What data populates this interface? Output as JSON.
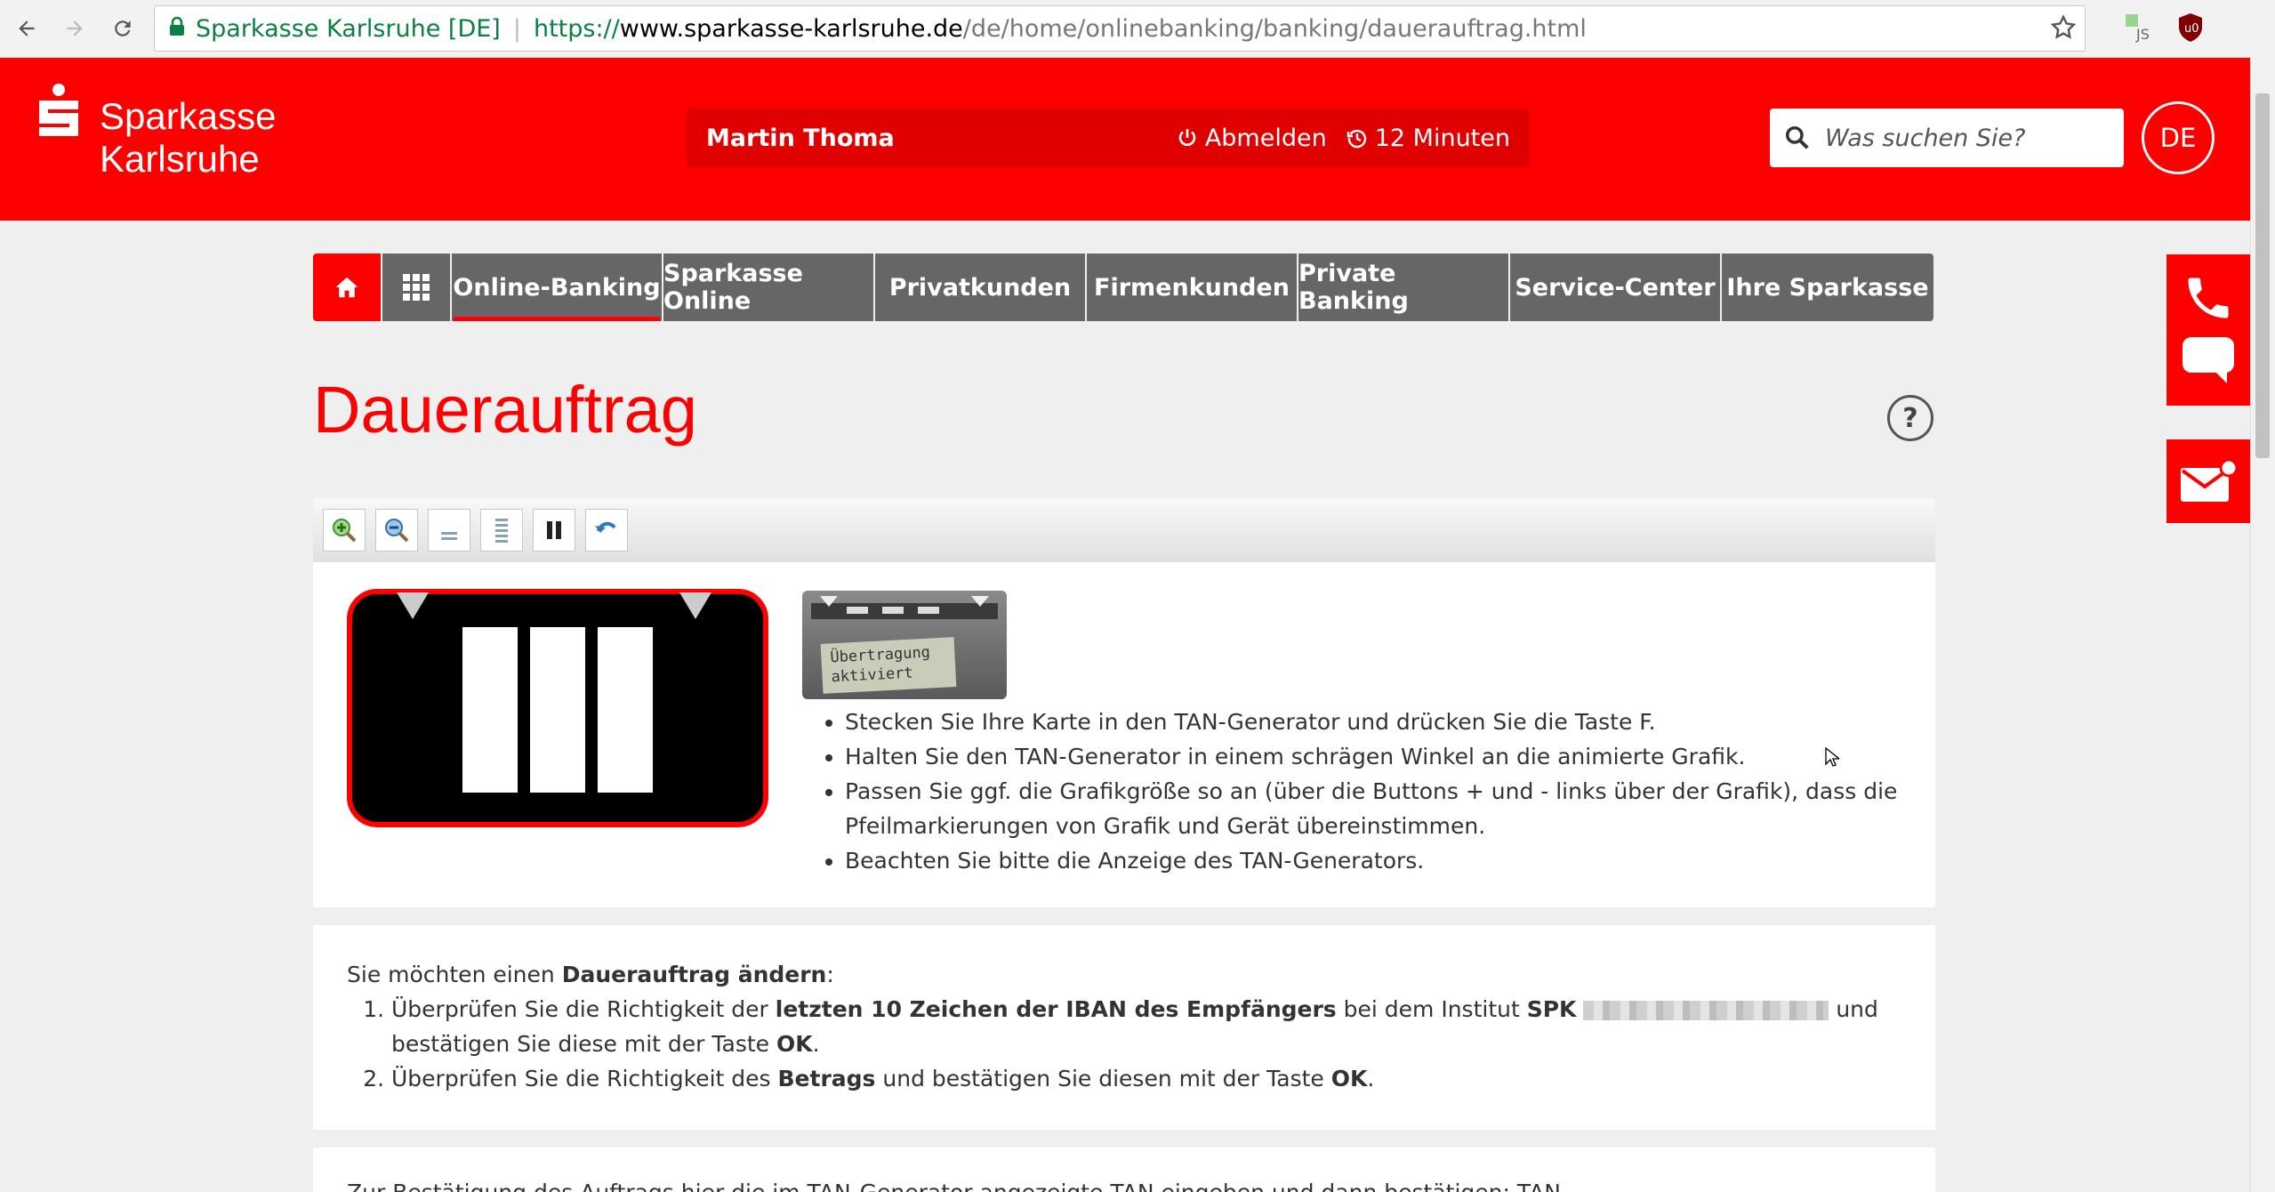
{
  "browser": {
    "secure_label": "Sparkasse Karlsruhe [DE]",
    "url_scheme": "https://",
    "url_host": "www.sparkasse-karlsruhe.de",
    "url_path": "/de/home/onlinebanking/banking/dauerauftrag.html",
    "icons": [
      "back-arrow-icon",
      "forward-arrow-icon",
      "reload-icon",
      "lock-icon",
      "star-icon",
      "js-extension-icon",
      "ublock-icon"
    ]
  },
  "header": {
    "logo_line1": "Sparkasse",
    "logo_line2": "Karlsruhe",
    "user_name": "Martin Thoma",
    "logout_label": "Abmelden",
    "session_timer": "12 Minuten",
    "search_placeholder": "Was suchen Sie?",
    "language": "DE",
    "brand_color": "#ff0000"
  },
  "nav": {
    "items": [
      {
        "label": "Online-Banking",
        "active": true
      },
      {
        "label": "Sparkasse Online"
      },
      {
        "label": "Privatkunden"
      },
      {
        "label": "Firmenkunden"
      },
      {
        "label": "Private Banking"
      },
      {
        "label": "Service-Center"
      },
      {
        "label": "Ihre Sparkasse"
      }
    ]
  },
  "page": {
    "title": "Dauerauftrag",
    "help_label": "?"
  },
  "device": {
    "display_line1": "Übertragung",
    "display_line2": "aktiviert"
  },
  "instructions": [
    "Stecken Sie Ihre Karte in den TAN-Generator und drücken Sie die Taste F.",
    "Halten Sie den TAN-Generator in einem schrägen Winkel an die animierte Grafik.",
    "Passen Sie ggf. die Grafikgröße so an (über die Buttons + und - links über der Grafik), dass die Pfeilmarkierungen von Grafik und Gerät übereinstimmen.",
    "Beachten Sie bitte die Anzeige des TAN-Generators."
  ],
  "change": {
    "intro_prefix": "Sie möchten einen ",
    "intro_bold": "Dauerauftrag ändern",
    "intro_suffix": ":",
    "step1_a": "Überprüfen Sie die Richtigkeit der ",
    "step1_bold": "letzten 10 Zeichen der IBAN des Empfängers",
    "step1_b": " bei dem Institut ",
    "step1_bank": "SPK",
    "step1_c": " und bestätigen Sie diese mit der Taste ",
    "step1_ok": "OK",
    "step1_end": ".",
    "step2_a": "Überprüfen Sie die Richtigkeit des ",
    "step2_bold": "Betrags",
    "step2_b": " und bestätigen Sie diesen mit der Taste ",
    "step2_ok": "OK",
    "step2_end": "."
  },
  "confirm_text": "Zur Bestätigung des Auftrags hier die im TAN-Generator angezeigte TAN eingeben und dann bestätigen: TAN"
}
